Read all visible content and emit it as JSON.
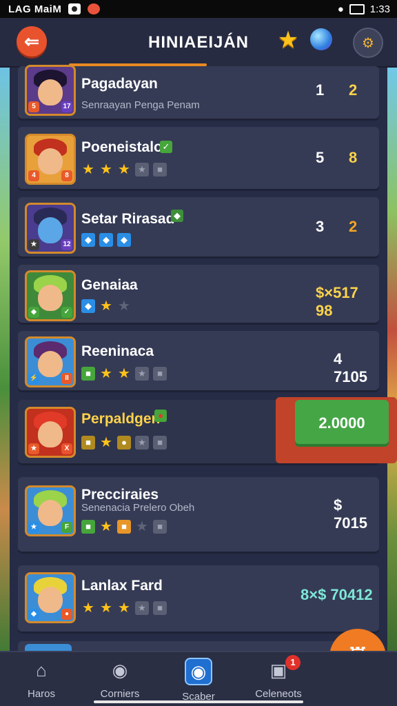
{
  "status_bar": {
    "title": "LAG MaiM",
    "time": "1:33"
  },
  "header": {
    "title": "HINIAEIJÁN",
    "back_icon": "arrow-left-icon",
    "star_icon": "star-icon",
    "orb_icon": "gem-icon",
    "settings_icon": "settings-icon"
  },
  "rows": [
    {
      "name": "Pagadayan",
      "subtitle": "Senraayan Penga Penam",
      "value_a": "1",
      "value_b": "2",
      "color_b": "#ffd34a"
    },
    {
      "name": "Poeneistaloa",
      "value_a": "5",
      "value_b": "8",
      "color_b": "#ffd34a",
      "stars": 3
    },
    {
      "name": "Setar Rirasad",
      "value_a": "3",
      "value_b": "2",
      "color_b": "#f5a623"
    },
    {
      "name": "Genaiaa",
      "value_text": "$×517  98",
      "color_text": "#ffd34a"
    },
    {
      "name": "Reeninaca",
      "value_text": "4 7105",
      "color_text": "#ffffff"
    },
    {
      "name": "Perpaldgen",
      "button_label": "2.0000"
    },
    {
      "name": "Precciraies",
      "subtitle": "Senenacia Prelero Obeh",
      "value_text": "$ 7015",
      "color_text": "#ffffff"
    },
    {
      "name": "Lanlax Fard",
      "value_text": "8×$ 70412",
      "color_text": "#7ee8d8"
    }
  ],
  "bottom_nav": [
    {
      "label": "Haros",
      "icon": "home-icon"
    },
    {
      "label": "Corniers",
      "icon": "bag-icon"
    },
    {
      "label": "Scaber",
      "icon": "shield-icon"
    },
    {
      "label": "Celeneots",
      "icon": "camera-icon",
      "badge": "1"
    }
  ],
  "fab_icon": "hero-icon"
}
